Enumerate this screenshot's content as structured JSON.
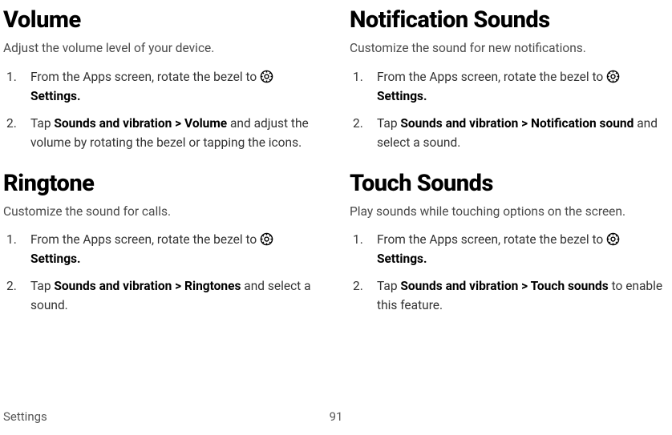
{
  "left": {
    "volume": {
      "heading": "Volume",
      "desc": "Adjust the volume level of your device.",
      "step1_a": "From the Apps screen, rotate the bezel to ",
      "step1_b": "Settings.",
      "step2_a": "Tap ",
      "step2_b": "Sounds and vibration",
      "step2_c": " > ",
      "step2_d": "Volume",
      "step2_e": " and adjust the volume by rotating the bezel or tapping the icons."
    },
    "ringtone": {
      "heading": "Ringtone",
      "desc": "Customize the sound for calls.",
      "step1_a": "From the Apps screen, rotate the bezel to ",
      "step1_b": "Settings.",
      "step2_a": "Tap ",
      "step2_b": "Sounds and vibration",
      "step2_c": " > ",
      "step2_d": "Ringtones",
      "step2_e": " and select a sound."
    }
  },
  "right": {
    "notification": {
      "heading": "Notification Sounds",
      "desc": "Customize the sound for new notifications.",
      "step1_a": "From the Apps screen, rotate the bezel to ",
      "step1_b": "Settings.",
      "step2_a": "Tap ",
      "step2_b": "Sounds and vibration",
      "step2_c": " > ",
      "step2_d": "Notification sound",
      "step2_e": " and select a sound."
    },
    "touch": {
      "heading": "Touch Sounds",
      "desc": "Play sounds while touching options on the screen.",
      "step1_a": "From the Apps screen, rotate the bezel to ",
      "step1_b": "Settings.",
      "step2_a": "Tap ",
      "step2_b": "Sounds and vibration",
      "step2_c": " > ",
      "step2_d": "Touch sounds",
      "step2_e": " to enable this feature."
    }
  },
  "footer": {
    "section": "Settings",
    "page": "91"
  }
}
